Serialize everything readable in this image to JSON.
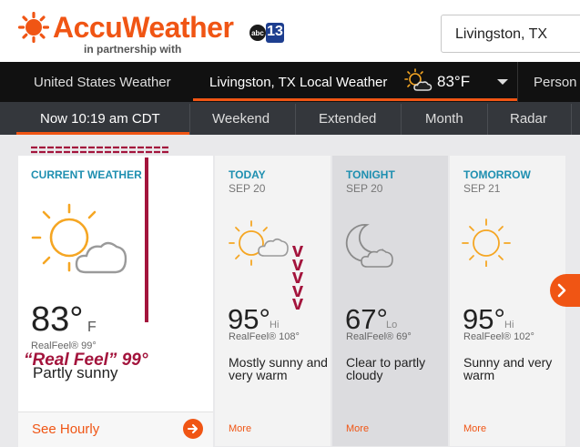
{
  "header": {
    "logo_text": "AccuWeather",
    "partner_text": "in partnership with",
    "station_badge": "13",
    "search_value": "Livingston, TX"
  },
  "nav": {
    "items": [
      "United States Weather",
      "Livingston, TX Local Weather",
      "Person"
    ],
    "current_temp": "83°F",
    "active_index": 1
  },
  "subnav": {
    "items": [
      "Now 10:19 am CDT",
      "Weekend",
      "Extended",
      "Month",
      "Radar"
    ],
    "active_index": 0
  },
  "current": {
    "title": "CURRENT WEATHER",
    "temp": "83°",
    "unit": "F",
    "realfeel": "RealFeel® 99°",
    "condition": "Partly sunny",
    "see_hourly": "See Hourly",
    "icon": "partly-sunny-icon"
  },
  "forecast": [
    {
      "title": "TODAY",
      "date": "SEP 20",
      "temp": "95°",
      "unit": "Hi",
      "realfeel": "RealFeel® 108°",
      "desc": "Mostly sunny and very warm",
      "more": "More",
      "icon": "partly-sunny-icon"
    },
    {
      "title": "TONIGHT",
      "date": "SEP 20",
      "temp": "67°",
      "unit": "Lo",
      "realfeel": "RealFeel® 69°",
      "desc": "Clear to partly cloudy",
      "more": "More",
      "icon": "moon-cloud-icon"
    },
    {
      "title": "TOMORROW",
      "date": "SEP 21",
      "temp": "95°",
      "unit": "Hi",
      "realfeel": "RealFeel® 102°",
      "desc": "Sunny and very warm",
      "more": "More",
      "icon": "sun-icon"
    }
  ],
  "annotations": {
    "realfeel_callout": "“Real Feel” 99°",
    "arrows": "v\nv\nv\nv\nv"
  },
  "colors": {
    "brand_orange": "#f05514",
    "title_blue": "#1e8fb0",
    "annotation_maroon": "#a3143c",
    "nav_bg": "#111111",
    "subnav_bg": "#34373c"
  }
}
